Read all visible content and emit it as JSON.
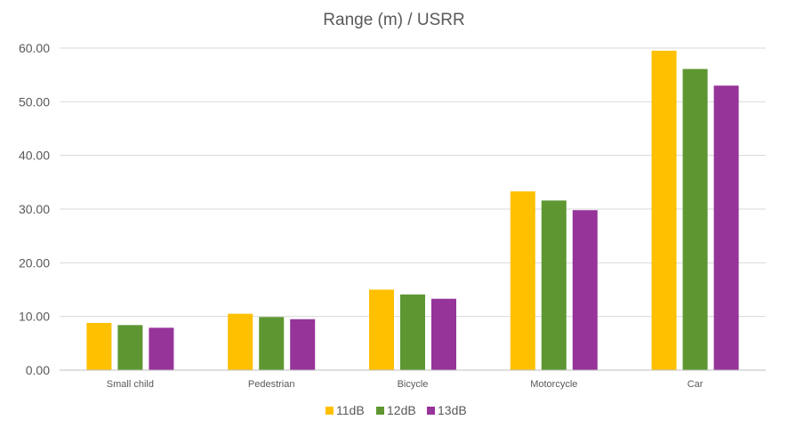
{
  "chart_data": {
    "type": "bar",
    "title": "Range (m) / USRR",
    "xlabel": "",
    "ylabel": "",
    "categories": [
      "Small child",
      "Pedestrian",
      "Bicycle",
      "Motorcycle",
      "Car"
    ],
    "series": [
      {
        "name": "11dB",
        "color": "#FFC000",
        "values": [
          8.8,
          10.5,
          15.0,
          33.3,
          59.5
        ]
      },
      {
        "name": "12dB",
        "color": "#5E9732",
        "values": [
          8.4,
          9.9,
          14.1,
          31.6,
          56.1
        ]
      },
      {
        "name": "13dB",
        "color": "#96349A",
        "values": [
          7.9,
          9.5,
          13.3,
          29.8,
          53.0
        ]
      }
    ],
    "ylim": [
      0,
      60
    ],
    "yticks": [
      "0.00",
      "10.00",
      "20.00",
      "30.00",
      "40.00",
      "50.00",
      "60.00"
    ],
    "grid": true,
    "legend_position": "bottom"
  }
}
